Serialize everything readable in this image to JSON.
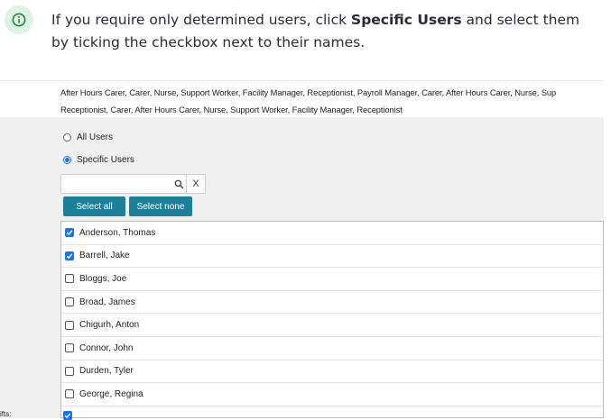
{
  "callout": {
    "icon": "info-icon",
    "text_before": "If you require only determined users, click ",
    "bold": "Specific Users",
    "text_after": " and select them by ticking the checkbox next to their names."
  },
  "roles": {
    "line1": "After Hours Carer, Carer, Nurse, Support Worker, Facility Manager, Receptionist, Payroll Manager, Carer, After Hours Carer, Nurse, Sup",
    "line2": "Receptionist, Carer, After Hours Carer, Nurse, Support Worker, Facility Manager, Receptionist"
  },
  "options": {
    "all_users": "All Users",
    "specific_users": "Specific Users",
    "selected": "specific_users"
  },
  "search": {
    "placeholder": "",
    "clear_label": "X"
  },
  "buttons": {
    "select_all": "Select all",
    "select_none": "Select none"
  },
  "users": [
    {
      "name": "Anderson, Thomas",
      "checked": true
    },
    {
      "name": "Barrell, Jake",
      "checked": true
    },
    {
      "name": "Bloggs, Joe",
      "checked": false
    },
    {
      "name": "Broad, James",
      "checked": false
    },
    {
      "name": "Chigurh, Anton",
      "checked": false
    },
    {
      "name": "Connor, John",
      "checked": false
    },
    {
      "name": "Durden, Tyler",
      "checked": false
    },
    {
      "name": "George, Regina",
      "checked": false
    }
  ],
  "shifts": {
    "label": "ifts:",
    "checked": true
  },
  "colors": {
    "accent": "#1e7f98",
    "checkbox": "#1a73e8",
    "callout_icon_bg": "#dff3e4",
    "callout_icon": "#1f7a3a"
  }
}
